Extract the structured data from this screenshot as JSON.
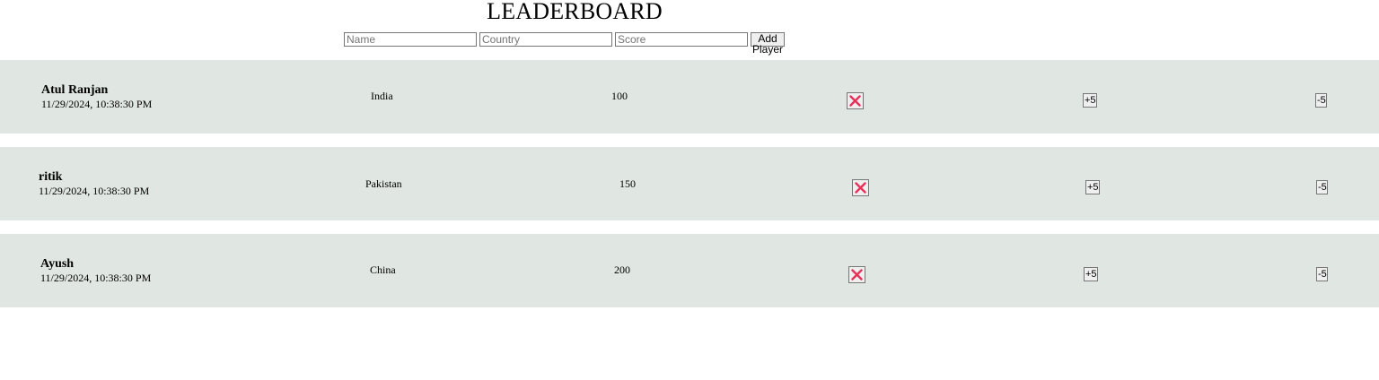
{
  "title": "LEADERBOARD",
  "form": {
    "name_placeholder": "Name",
    "country_placeholder": "Country",
    "score_placeholder": "Score",
    "add_label": "Add Player"
  },
  "players": [
    {
      "name": "Atul Ranjan",
      "date": "11/29/2024, 10:38:30 PM",
      "country": "India",
      "score": "100",
      "plus_label": "+5",
      "minus_label": "-5",
      "delete_icon": "close-icon"
    },
    {
      "name": "ritik",
      "date": "11/29/2024, 10:38:30 PM",
      "country": "Pakistan",
      "score": "150",
      "plus_label": "+5",
      "minus_label": "-5",
      "delete_icon": "close-icon"
    },
    {
      "name": "Ayush",
      "date": "11/29/2024, 10:38:30 PM",
      "country": "China",
      "score": "200",
      "plus_label": "+5",
      "minus_label": "-5",
      "delete_icon": "close-icon"
    }
  ],
  "colors": {
    "row_background": "#e0e6e2",
    "delete_icon": "#e8305a"
  }
}
